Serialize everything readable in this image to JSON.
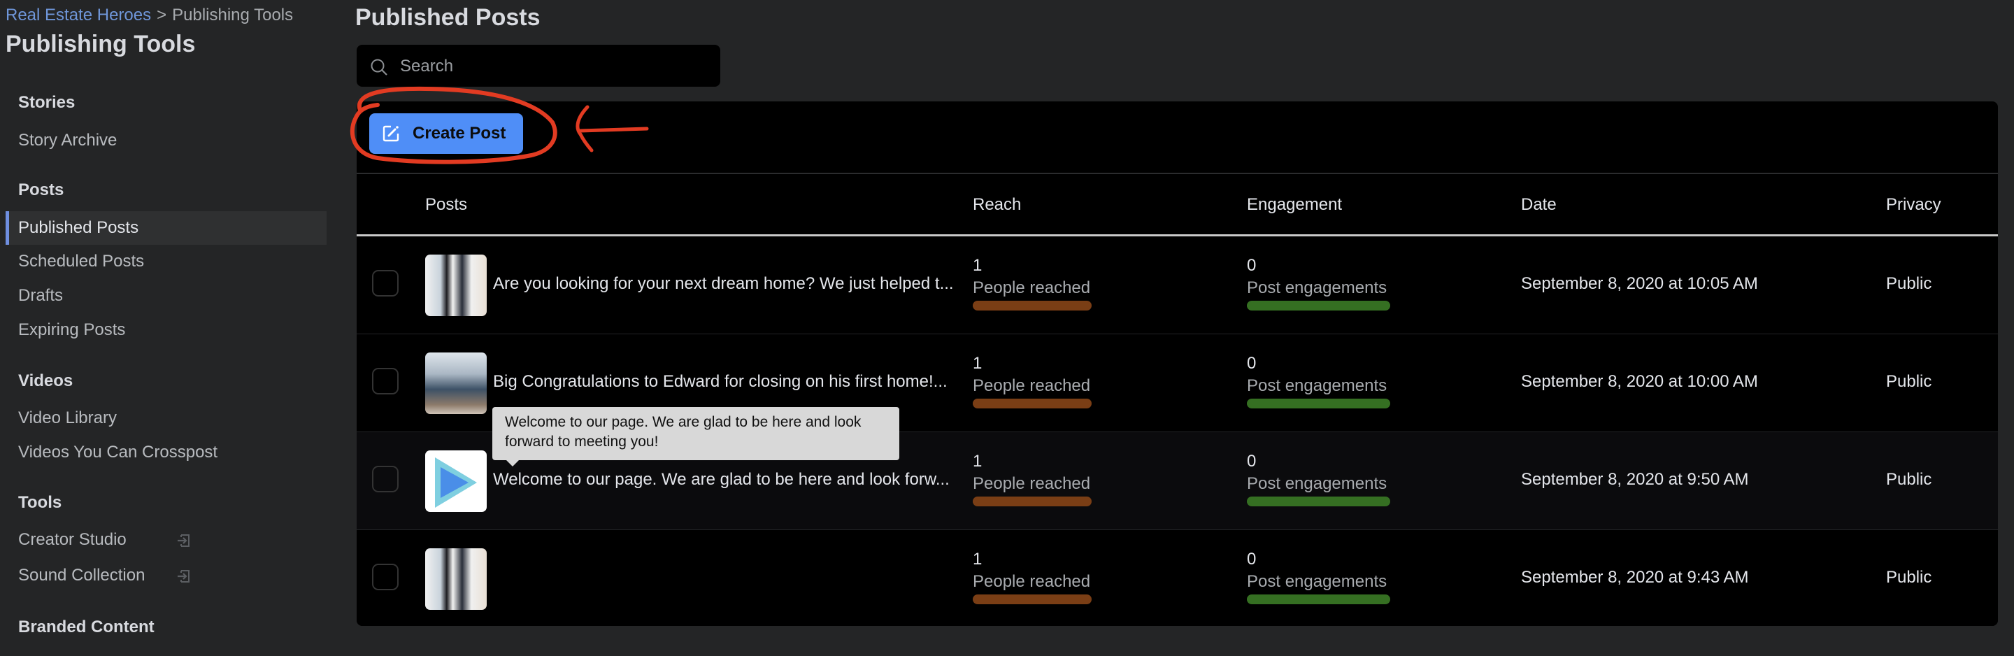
{
  "breadcrumb": {
    "parent": "Real Estate Heroes",
    "separator": ">",
    "current": "Publishing Tools"
  },
  "sidebar": {
    "title": "Publishing Tools",
    "sections": [
      {
        "label": "Stories",
        "items": [
          {
            "label": "Story Archive"
          }
        ]
      },
      {
        "label": "Posts",
        "items": [
          {
            "label": "Published Posts",
            "active": true
          },
          {
            "label": "Scheduled Posts"
          },
          {
            "label": "Drafts"
          },
          {
            "label": "Expiring Posts"
          }
        ]
      },
      {
        "label": "Videos",
        "items": [
          {
            "label": "Video Library"
          },
          {
            "label": "Videos You Can Crosspost"
          }
        ]
      },
      {
        "label": "Tools",
        "items": [
          {
            "label": "Creator Studio",
            "icon": "external-link-icon"
          },
          {
            "label": "Sound Collection",
            "icon": "external-link-icon"
          }
        ]
      },
      {
        "label": "Branded Content",
        "items": []
      }
    ]
  },
  "main": {
    "title": "Published Posts",
    "search": {
      "placeholder": "Search",
      "value": ""
    },
    "create_post_label": "Create Post",
    "columns": [
      "Posts",
      "Reach",
      "Engagement",
      "Date",
      "Privacy"
    ],
    "rows": [
      {
        "thumbnail": "photo",
        "text": "Are you looking for your next dream home? We just helped t...",
        "reach": "1",
        "reach_label": "People reached",
        "engagement": "0",
        "engagement_label": "Post engagements",
        "date": "September 8, 2020 at 10:05 AM",
        "privacy": "Public"
      },
      {
        "thumbnail": "photo",
        "text": "Big Congratulations to Edward for closing on his first home!...",
        "reach": "1",
        "reach_label": "People reached",
        "engagement": "0",
        "engagement_label": "Post engagements",
        "date": "September 8, 2020 at 10:00 AM",
        "privacy": "Public"
      },
      {
        "thumbnail": "video",
        "text": "Welcome to our page. We are glad to be here and look forw...",
        "reach": "1",
        "reach_label": "People reached",
        "engagement": "0",
        "engagement_label": "Post engagements",
        "date": "September 8, 2020 at 9:50 AM",
        "privacy": "Public"
      },
      {
        "thumbnail": "photo",
        "text": "",
        "reach": "1",
        "reach_label": "People reached",
        "engagement": "0",
        "engagement_label": "Post engagements",
        "date": "September 8, 2020 at 9:43 AM",
        "privacy": "Public"
      }
    ],
    "tooltip": "Welcome to our page. We are glad to be here and look forward to meeting you!"
  },
  "colors": {
    "accent": "#4f8ef7",
    "reach_bar": "#7a3e15",
    "engagement_bar": "#356f22",
    "annotation": "#e23b22",
    "active_marker": "#6f8fe0"
  }
}
